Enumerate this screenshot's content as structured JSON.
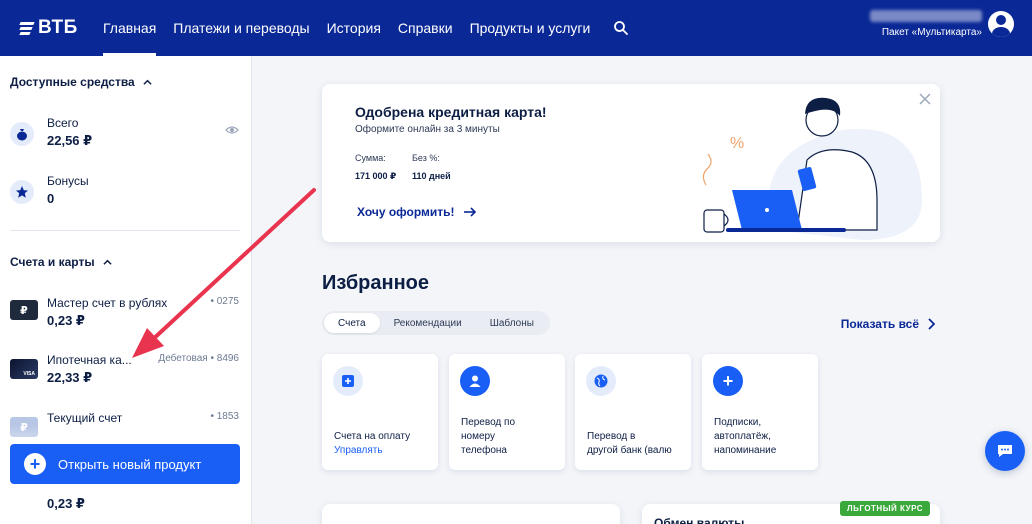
{
  "header": {
    "logo": "ВТБ",
    "nav": [
      "Главная",
      "Платежи и переводы",
      "История",
      "Справки",
      "Продукты и услуги"
    ],
    "package": "Пакет «Мультикарта»"
  },
  "sidebar": {
    "available": {
      "title": "Доступные средства",
      "items": [
        {
          "label": "Всего",
          "value": "22,56 ₽"
        },
        {
          "label": "Бонусы",
          "value": "0"
        }
      ]
    },
    "accounts": {
      "title": "Счета и карты",
      "items": [
        {
          "label": "Мастер счет в рублях",
          "value": "0,23 ₽",
          "right": "• 0275",
          "icon": "ruble-icon"
        },
        {
          "label": "Ипотечная ка...",
          "value": "22,33 ₽",
          "right": "Дебетовая • 8496",
          "icon": "visa-card-icon"
        },
        {
          "label": "Текущий счет",
          "value": "",
          "right": "• 1853",
          "icon": "ruble-icon"
        }
      ]
    },
    "open_button": "Открыть новый продукт",
    "bottom_value": "0,23 ₽"
  },
  "banner": {
    "title": "Одобрена кредитная карта!",
    "subtitle": "Оформите онлайн за 3 минуты",
    "sum_label": "Сумма:",
    "sum_value": "171 000 ₽",
    "free_label": "Без %:",
    "free_value": "110 дней",
    "cta": "Хочу оформить!"
  },
  "favorites": {
    "title": "Избранное",
    "tabs": [
      "Счета",
      "Рекомендации",
      "Шаблоны"
    ],
    "active_tab": "Счета",
    "show_all": "Показать всё",
    "tiles": [
      {
        "line1": "Счета на оплату",
        "link": "Управлять"
      },
      {
        "text": "Перевод по\nномеру\nтелефона"
      },
      {
        "text": "Перевод в\nдругой банк (валю"
      },
      {
        "text": "Подписки,\nавтоплатёж,\nнапоминание"
      }
    ]
  },
  "bottom": {
    "exchange_title": "Обмен валюты",
    "badge": "ЛЬГОТНЫЙ КУРС"
  },
  "colors": {
    "brand": "#0a2896",
    "accent": "#1a5ff5",
    "annotation": "#e8344e"
  }
}
